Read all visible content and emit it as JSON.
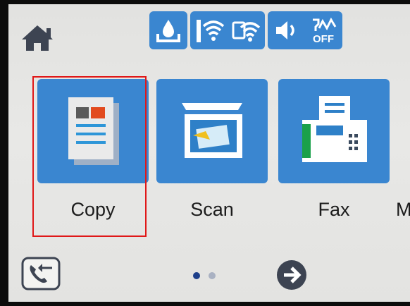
{
  "apps": {
    "copy_label": "Copy",
    "scan_label": "Scan",
    "fax_label": "Fax",
    "more_label_partial": "M"
  },
  "status_icons": [
    "ink-level-icon",
    "wifi-icon",
    "wifi-direct-icon",
    "volume-icon",
    "fax-quiet-mode-off-icon"
  ],
  "status_text": {
    "fax_mode_badge": "OFF"
  },
  "pagination": {
    "current_page": 1,
    "total_pages": 2
  },
  "colors": {
    "tile_blue": "#3a86d0",
    "selection_red": "#e01818",
    "screen_bg": "#e6e6e4",
    "nav_dark": "#3d4452"
  }
}
